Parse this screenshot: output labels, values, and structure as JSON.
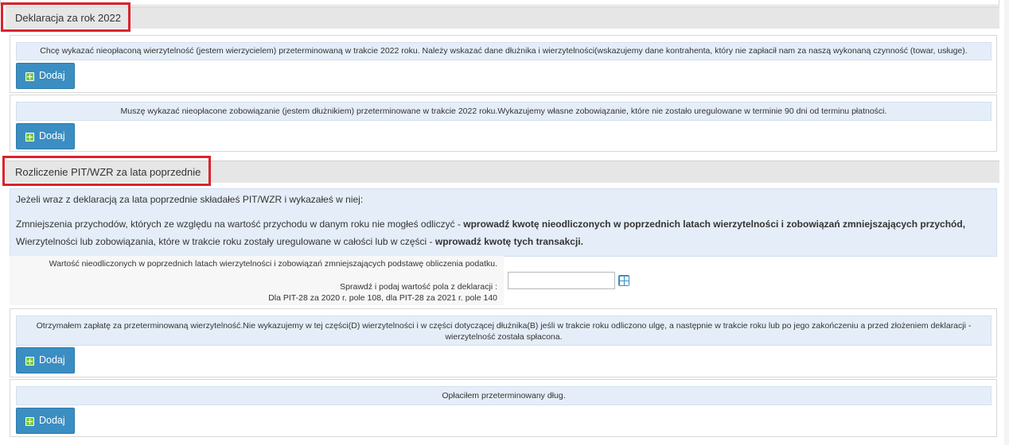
{
  "sections": {
    "declaration": {
      "title": "Deklaracja za rok 2022"
    },
    "pit": {
      "title": "Rozliczenie PIT/WZR za lata poprzednie"
    }
  },
  "panels": {
    "creditor": {
      "info": "Chcę wykazać nieopłaconą wierzytelność (jestem wierzycielem) przeterminowaną w trakcie 2022 roku. Należy wskazać dane dłużnika i wierzytelności(wskazujemy dane kontrahenta, który nie zapłacił nam za naszą wykonaną czynność (towar, usługe).",
      "button": "Dodaj"
    },
    "debtor": {
      "info": "Muszę wykazać nieopłacone zobowiązanie (jestem dłużnikiem) przeterminowane w trakcie 2022 roku.Wykazujemy własne zobowiązanie, które nie zostało uregulowane w terminie 90 dni od terminu płatności.",
      "button": "Dodaj"
    },
    "received": {
      "info_line1": "Otrzymałem zapłatę za przeterminowaną wierzytelność.Nie wykazujemy w tej części(D) wierzytelności i w części dotyczącej dłużnika(B) jeśli w trakcie roku odliczono ulgę, a następnie w trakcie roku lub po jego zakończeniu a przed złożeniem deklaracji -",
      "info_line2": "wierzytelność została spłacona.",
      "button": "Dodaj"
    },
    "paid": {
      "info": "Opłaciłem przeterminowany dług.",
      "button": "Dodaj"
    }
  },
  "pit_info": {
    "line1": "Jeżeli wraz z deklaracją za lata poprzednie składałeś PIT/WZR i wykazałeś w niej:",
    "line2_normal": "Zmniejszenia przychodów, których ze względu na wartość przychodu w danym roku nie mogłeś odliczyć - ",
    "line2_bold": "wprowadź kwotę nieodliczonych w poprzednich latach wierzytelności i zobowiązań zmniejszających przychód,",
    "line3_normal": "Wierzytelności lub zobowiązania, które w trakcie roku zostały uregulowane w całości lub w części - ",
    "line3_bold": "wprowadź kwotę tych transakcji."
  },
  "field": {
    "label": "Wartość nieodliczonych w poprzednich latach wierzytelności i zobowiązań zmniejszających podstawę obliczenia podatku.",
    "hint1": "Sprawdź i podaj wartość pola z deklaracji :",
    "hint2": "Dla PIT-28 za 2020 r. pole 108, dla PIT-28 za 2021 r. pole 140",
    "value": "",
    "icon": "calculator-icon"
  },
  "colors": {
    "highlight": "#d9232d",
    "button": "#3b8ec2",
    "info_bg": "#e5eef8"
  }
}
